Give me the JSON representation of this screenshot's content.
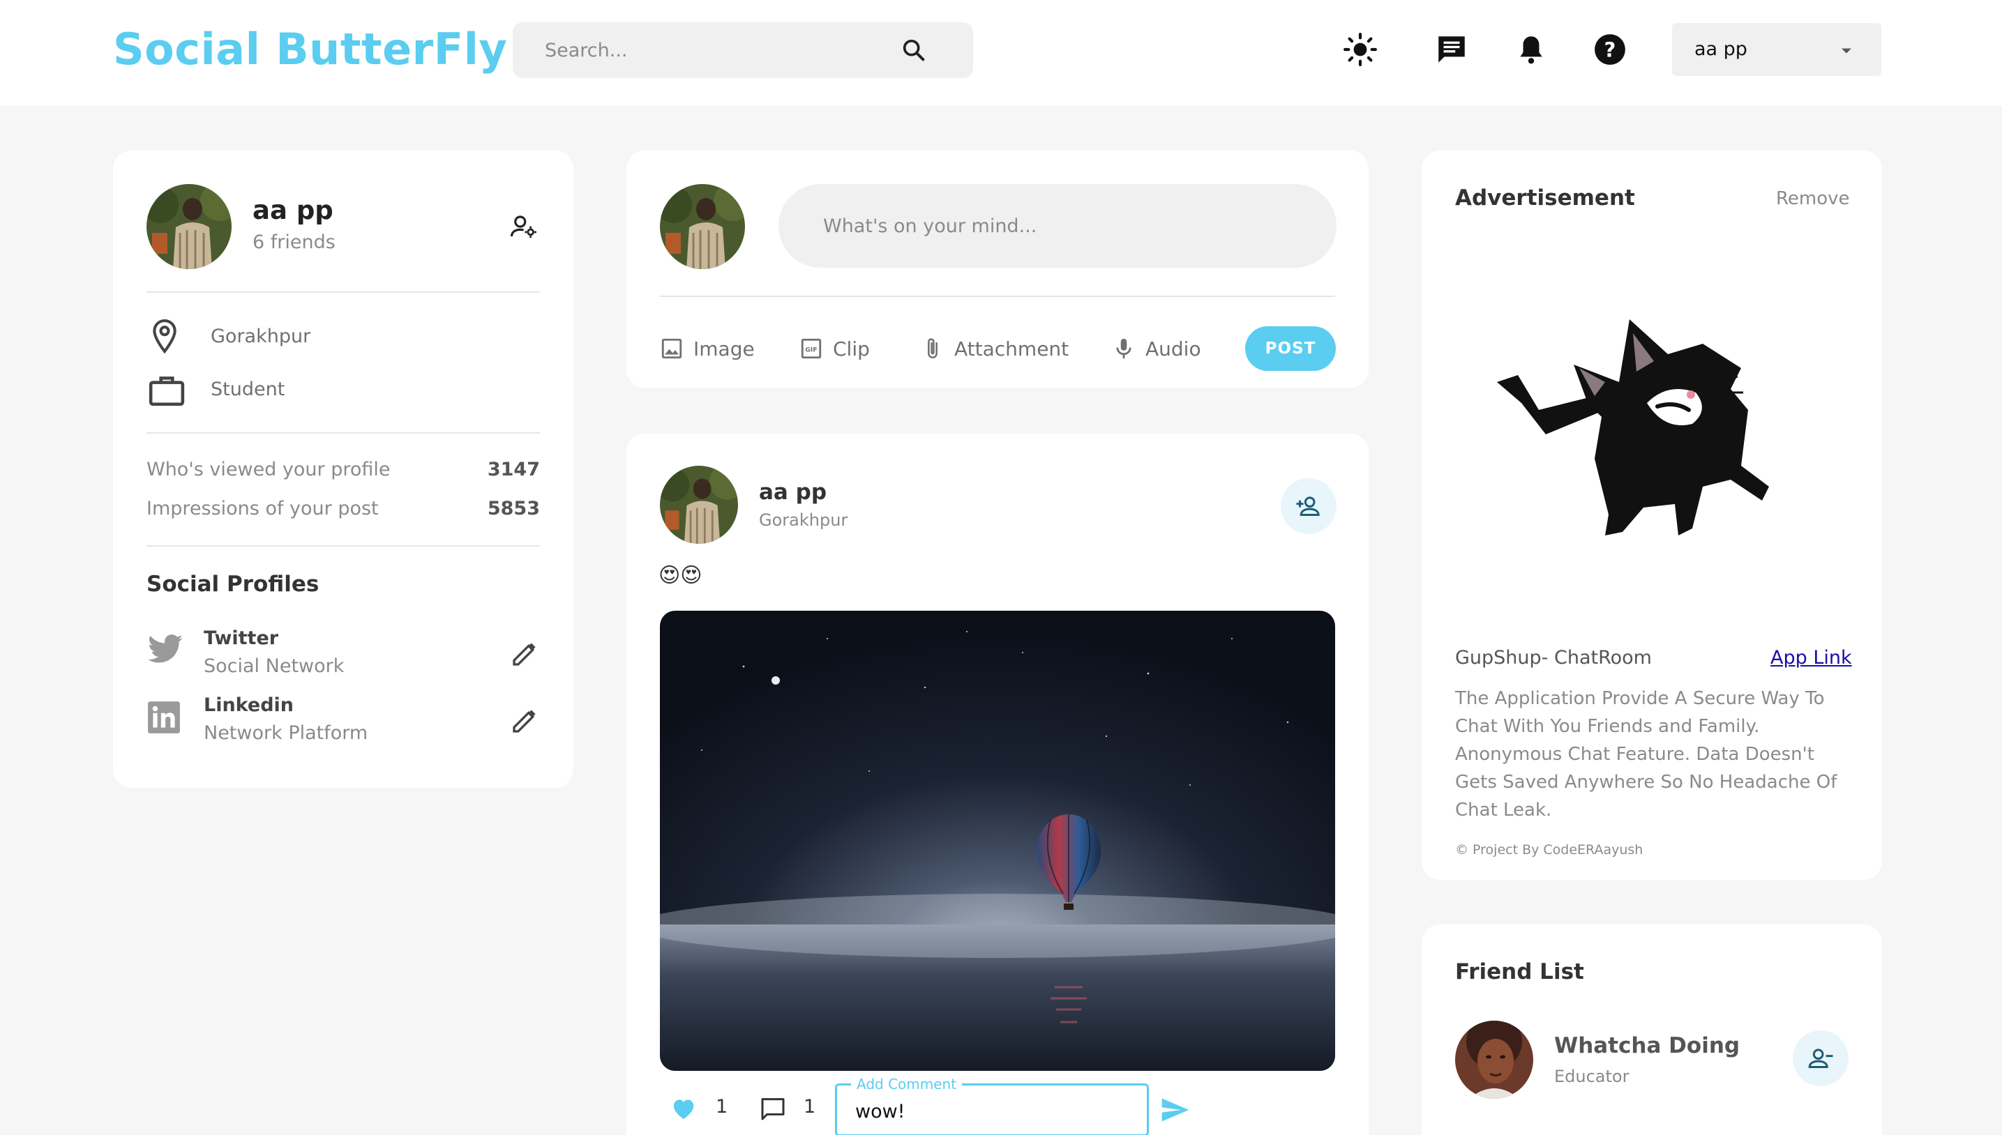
{
  "header": {
    "brand": "Social ButterFly",
    "search_placeholder": "Search...",
    "user_menu_label": "aa pp"
  },
  "profile_card": {
    "name": "aa pp",
    "friends": "6 friends",
    "location": "Gorakhpur",
    "occupation": "Student",
    "stats": [
      {
        "label": "Who's viewed your profile",
        "value": "3147"
      },
      {
        "label": "Impressions of your post",
        "value": "5853"
      }
    ],
    "social_title": "Social Profiles",
    "socials": [
      {
        "name": "Twitter",
        "sub": "Social Network"
      },
      {
        "name": "Linkedin",
        "sub": "Network Platform"
      }
    ]
  },
  "composer": {
    "placeholder": "What's on your mind...",
    "tools": [
      "Image",
      "Clip",
      "Attachment",
      "Audio"
    ],
    "post_label": "POST"
  },
  "post": {
    "author": "aa pp",
    "location": "Gorakhpur",
    "caption": "😍😍",
    "likes": "1",
    "comments": "1",
    "comment_legend": "Add Comment",
    "comment_value": "wow!"
  },
  "advertisement": {
    "title": "Advertisement",
    "remove": "Remove",
    "name": "GupShup- ChatRoom",
    "link": "App Link",
    "description": "The Application Provide A Secure Way To Chat With You Friends and Family. Anonymous Chat Feature. Data Doesn't Gets Saved Anywhere So No Headache Of Chat Leak.",
    "credit": "© Project By CodeERAayush"
  },
  "friend_list": {
    "title": "Friend List",
    "friends": [
      {
        "name": "Whatcha Doing",
        "role": "Educator"
      }
    ]
  },
  "colors": {
    "accent": "#5bcdf0",
    "background": "#f6f6f6",
    "card": "#ffffff"
  },
  "icons": [
    "search-icon",
    "sun-icon",
    "chat-icon",
    "bell-icon",
    "help-icon",
    "caret-down-icon",
    "manage-account-icon",
    "location-icon",
    "briefcase-icon",
    "twitter-icon",
    "linkedin-icon",
    "edit-icon",
    "image-icon",
    "gif-icon",
    "attachment-icon",
    "mic-icon",
    "person-add-icon",
    "heart-icon",
    "comment-icon",
    "send-icon",
    "person-remove-icon"
  ]
}
